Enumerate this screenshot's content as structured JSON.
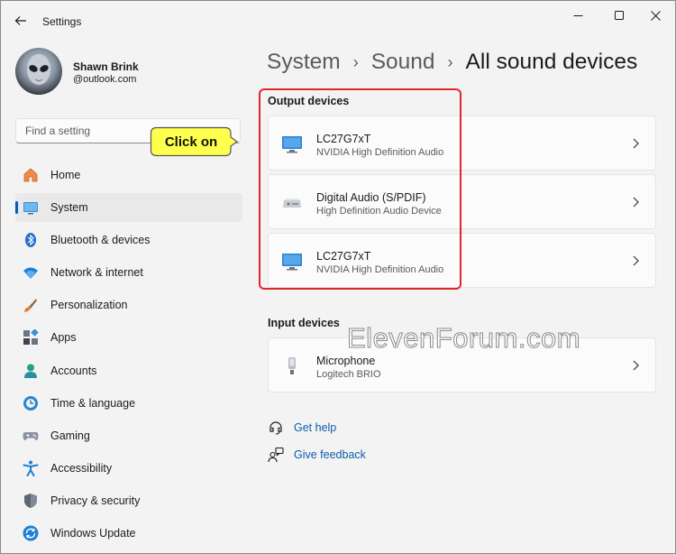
{
  "window": {
    "title": "Settings",
    "controls": [
      "minimize",
      "maximize",
      "close"
    ]
  },
  "profile": {
    "name": "Shawn Brink",
    "email": "@outlook.com"
  },
  "search": {
    "placeholder": "Find a setting"
  },
  "nav": {
    "items": [
      {
        "label": "Home",
        "icon": "home-icon"
      },
      {
        "label": "System",
        "icon": "system-icon",
        "active": true
      },
      {
        "label": "Bluetooth & devices",
        "icon": "bluetooth-icon"
      },
      {
        "label": "Network & internet",
        "icon": "wifi-icon"
      },
      {
        "label": "Personalization",
        "icon": "brush-icon"
      },
      {
        "label": "Apps",
        "icon": "apps-icon"
      },
      {
        "label": "Accounts",
        "icon": "accounts-icon"
      },
      {
        "label": "Time & language",
        "icon": "clock-globe-icon"
      },
      {
        "label": "Gaming",
        "icon": "gamepad-icon"
      },
      {
        "label": "Accessibility",
        "icon": "accessibility-icon"
      },
      {
        "label": "Privacy & security",
        "icon": "shield-icon"
      },
      {
        "label": "Windows Update",
        "icon": "update-icon"
      }
    ]
  },
  "breadcrumb": {
    "items": [
      "System",
      "Sound",
      "All sound devices"
    ],
    "separator": "›"
  },
  "output": {
    "title": "Output devices",
    "devices": [
      {
        "name": "LC27G7xT",
        "sub": "NVIDIA High Definition Audio",
        "icon": "monitor-icon"
      },
      {
        "name": "Digital Audio (S/PDIF)",
        "sub": "High Definition Audio Device",
        "icon": "audio-receiver-icon"
      },
      {
        "name": "LC27G7xT",
        "sub": "NVIDIA High Definition Audio",
        "icon": "monitor-icon"
      }
    ]
  },
  "input": {
    "title": "Input devices",
    "devices": [
      {
        "name": "Microphone",
        "sub": "Logitech BRIO",
        "icon": "microphone-icon"
      }
    ]
  },
  "links": {
    "help": "Get help",
    "feedback": "Give feedback"
  },
  "annotation": {
    "callout": "Click on",
    "highlight_color": "#e0262a",
    "callout_color": "#ffff4d"
  },
  "watermark": "ElevenForum.com",
  "colors": {
    "accent": "#005fb8",
    "link": "#0f5cad",
    "background": "#f3f3f3"
  }
}
